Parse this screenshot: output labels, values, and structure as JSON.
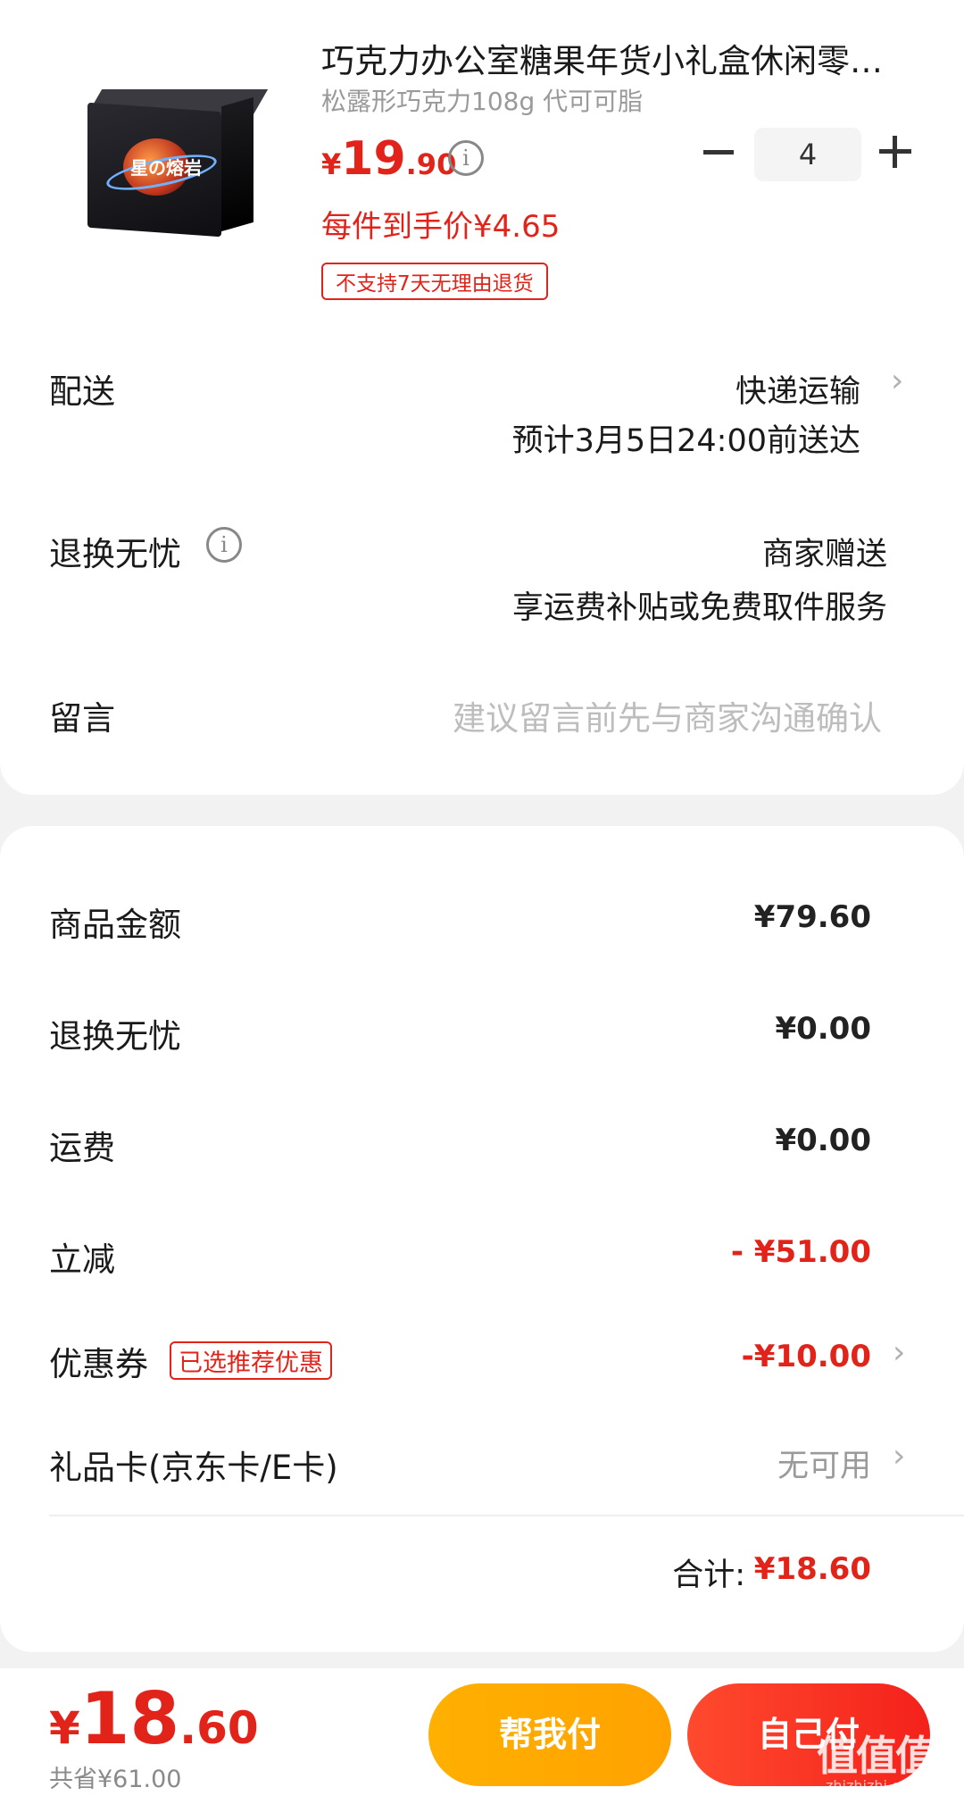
{
  "product": {
    "title": "巧克力办公室糖果年货小礼盒休闲零…",
    "sku": "松露形巧克力108g 代可可脂",
    "price_symbol": "¥",
    "price_int": "19",
    "price_dec": ".90",
    "unit_price": "每件到手价¥4.65",
    "no_return_tag": "不支持7天无理由退货",
    "quantity": "4",
    "image_text": "星の熔岩"
  },
  "delivery": {
    "label": "配送",
    "method": "快递运输",
    "eta": "预计3月5日24:00前送达"
  },
  "worry_free": {
    "label": "退换无忧",
    "value_line1": "商家赠送",
    "value_line2": "享运费补贴或免费取件服务"
  },
  "message": {
    "label": "留言",
    "placeholder": "建议留言前先与商家沟通确认"
  },
  "summary": {
    "goods_label": "商品金额",
    "goods_value": "¥79.60",
    "worry_label": "退换无忧",
    "worry_value": "¥0.00",
    "shipping_label": "运费",
    "shipping_value": "¥0.00",
    "discount_label": "立减",
    "discount_value": "- ¥51.00",
    "coupon_label": "优惠券",
    "coupon_tag": "已选推荐优惠",
    "coupon_value": "-¥10.00",
    "giftcard_label": "礼品卡(京东卡/E卡)",
    "giftcard_value": "无可用",
    "total_label": "合计:",
    "total_value": "¥18.60"
  },
  "bottom": {
    "symbol": "¥",
    "total_int": "18",
    "total_dec": ".60",
    "saved": "共省¥61.00",
    "help_pay": "帮我付",
    "self_pay": "自己付"
  },
  "watermark": {
    "text": "值值值",
    "sub": "zhizhizhi.com"
  },
  "colors": {
    "accent_red": "#e2231a",
    "help_orange": "#ffb000"
  }
}
